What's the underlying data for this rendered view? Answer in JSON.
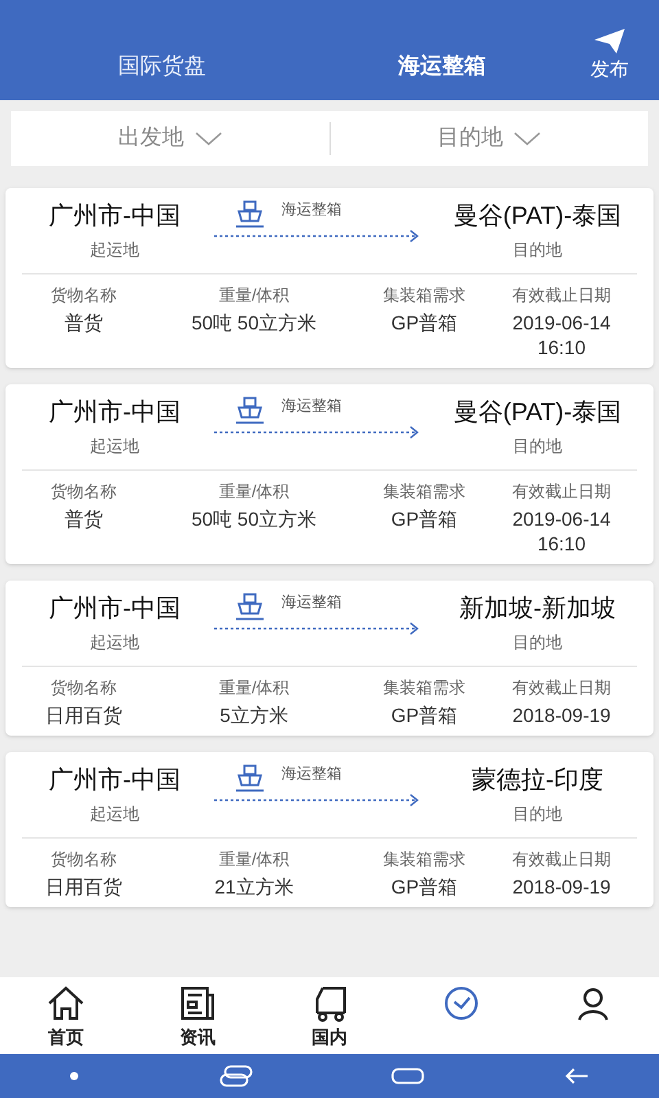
{
  "header": {
    "tabs": [
      {
        "label": "国际货盘",
        "selected": false
      },
      {
        "label": "海运整箱",
        "selected": true
      }
    ],
    "publish": "发布"
  },
  "filters": [
    "出发地",
    "目的地"
  ],
  "cards": [
    {
      "origin": "广州市-中国",
      "origin_label": "起运地",
      "mode": "海运整箱",
      "destination": "曼谷(PAT)-泰国",
      "destination_label": "目的地",
      "fields": [
        {
          "label": "货物名称",
          "value": "普货"
        },
        {
          "label": "重量/体积",
          "value": "50吨 50立方米"
        },
        {
          "label": "集装箱需求",
          "value": "GP普箱"
        },
        {
          "label": "有效截止日期",
          "value": "2019-06-14 16:10"
        }
      ]
    },
    {
      "origin": "广州市-中国",
      "origin_label": "起运地",
      "mode": "海运整箱",
      "destination": "曼谷(PAT)-泰国",
      "destination_label": "目的地",
      "fields": [
        {
          "label": "货物名称",
          "value": "普货"
        },
        {
          "label": "重量/体积",
          "value": "50吨 50立方米"
        },
        {
          "label": "集装箱需求",
          "value": "GP普箱"
        },
        {
          "label": "有效截止日期",
          "value": "2019-06-14 16:10"
        }
      ]
    },
    {
      "origin": "广州市-中国",
      "origin_label": "起运地",
      "mode": "海运整箱",
      "destination": "新加坡-新加坡",
      "destination_label": "目的地",
      "fields": [
        {
          "label": "货物名称",
          "value": "日用百货"
        },
        {
          "label": "重量/体积",
          "value": "5立方米"
        },
        {
          "label": "集装箱需求",
          "value": "GP普箱"
        },
        {
          "label": "有效截止日期",
          "value": "2018-09-19"
        }
      ]
    },
    {
      "origin": "广州市-中国",
      "origin_label": "起运地",
      "mode": "海运整箱",
      "destination": "蒙德拉-印度",
      "destination_label": "目的地",
      "fields": [
        {
          "label": "货物名称",
          "value": "日用百货"
        },
        {
          "label": "重量/体积",
          "value": "21立方米"
        },
        {
          "label": "集装箱需求",
          "value": "GP普箱"
        },
        {
          "label": "有效截止日期",
          "value": "2018-09-19"
        }
      ]
    }
  ],
  "bottom_nav": [
    {
      "kind": "home",
      "label": "首页",
      "selected": false
    },
    {
      "kind": "news",
      "label": "资讯",
      "selected": false
    },
    {
      "kind": "truck",
      "label": "国内",
      "selected": false
    },
    {
      "kind": "ship",
      "selected": true
    },
    {
      "kind": "user",
      "selected": false
    }
  ]
}
